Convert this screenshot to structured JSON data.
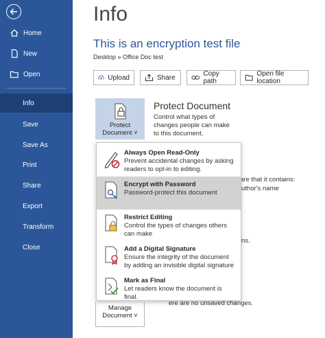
{
  "sidebar": {
    "items": [
      {
        "label": "Home",
        "icon": "home-icon"
      },
      {
        "label": "New",
        "icon": "new-document-icon"
      },
      {
        "label": "Open",
        "icon": "folder-open-icon"
      },
      {
        "label": "Info"
      },
      {
        "label": "Save"
      },
      {
        "label": "Save As"
      },
      {
        "label": "Print"
      },
      {
        "label": "Share"
      },
      {
        "label": "Export"
      },
      {
        "label": "Transform"
      },
      {
        "label": "Close"
      }
    ]
  },
  "page": {
    "title": "Info",
    "filename": "This is an encryption test file",
    "path": "Desktop » Office Doc test"
  },
  "toolbar": {
    "upload": "Upload",
    "share": "Share",
    "copy_path": "Copy path",
    "open_location": "Open file location"
  },
  "protect": {
    "tile_line1": "Protect",
    "tile_line2": "Document ˅",
    "title": "Protect Document",
    "description": "Control what types of changes people can make to this document."
  },
  "background": {
    "inspect_fragment": "are that it contains:",
    "author_fragment": "uthor's name",
    "versions_fragment": "ns.",
    "unsaved_fragment": "ere are no unsaved changes."
  },
  "manage": {
    "line1": "Manage",
    "line2": "Document ˅"
  },
  "menu": {
    "items": [
      {
        "title": "Always Open Read-Only",
        "desc": "Prevent accidental changes by asking readers to opt-in to editing."
      },
      {
        "title": "Encrypt with Password",
        "desc": "Password-protect this document"
      },
      {
        "title": "Restrict Editing",
        "desc": "Control the types of changes others can make"
      },
      {
        "title": "Add a Digital Signature",
        "desc": "Ensure the integrity of the document by adding an invisible digital signature"
      },
      {
        "title": "Mark as Final",
        "desc": "Let readers know the document is final."
      }
    ]
  },
  "colors": {
    "sidebar": "#2b579a",
    "sidebar_active": "#1e4175",
    "accent": "#2b579a",
    "highlight": "#d2d2d2"
  }
}
